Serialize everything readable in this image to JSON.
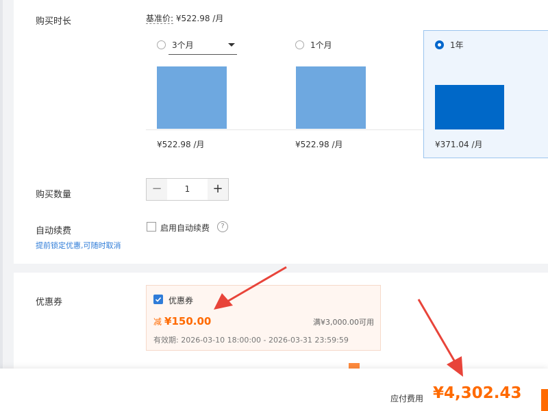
{
  "duration": {
    "label": "购买时长",
    "base_price_label": "基准价:",
    "base_price_value": "¥522.98 /月",
    "options": [
      {
        "label": "3个月",
        "price": "¥522.98 /月",
        "selected": false
      },
      {
        "label": "1个月",
        "price": "¥522.98 /月",
        "selected": false
      },
      {
        "label": "1年",
        "price": "¥371.04 /月",
        "selected": true
      }
    ]
  },
  "quantity": {
    "label": "购买数量",
    "value": "1",
    "minus": "−",
    "plus": "+"
  },
  "auto_renew": {
    "label": "自动续费",
    "hint": "提前锁定优惠,可随时取消",
    "checkbox_label": "启用自动续费",
    "help": "?"
  },
  "coupon": {
    "label": "优惠券",
    "name": "优惠券",
    "discount_prefix": "减",
    "discount_amount": "¥150.00",
    "condition": "满¥3,000.00可用",
    "validity": "有效期: 2026-03-10 18:00:00 - 2026-03-31 23:59:59"
  },
  "footer": {
    "due_label": "应付费用",
    "due_amount": "¥4,302.43"
  },
  "colors": {
    "accent": "#0068c8",
    "bar": "#6ea8e0",
    "price_orange": "#ff6a00",
    "arrow_red": "#e8443a"
  }
}
